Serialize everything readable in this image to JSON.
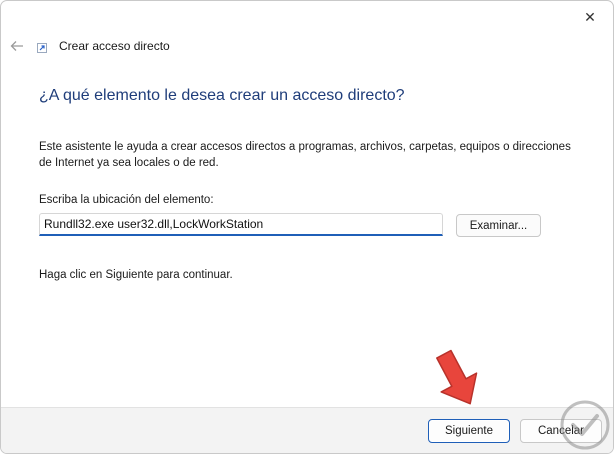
{
  "window": {
    "title": "Crear acceso directo",
    "close_label": "✕"
  },
  "wizard": {
    "heading": "¿A qué elemento le desea crear un acceso directo?",
    "description": "Este asistente le ayuda a crear accesos directos a programas, archivos, carpetas, equipos o direcciones de Internet ya sea locales o de red.",
    "location_label": "Escriba la ubicación del elemento:",
    "location_value": "Rundll32.exe user32.dll,LockWorkStation",
    "browse_label": "Examinar...",
    "continue_text": "Haga clic en Siguiente para continuar."
  },
  "footer": {
    "next_label": "Siguiente",
    "cancel_label": "Cancelar"
  },
  "icons": {
    "back": "back-arrow-icon",
    "close": "close-icon",
    "title": "shortcut-icon",
    "annotation": "red-arrow",
    "watermark": "solvetic-logo"
  },
  "colors": {
    "heading": "#1f3d7a",
    "accent": "#1f5fb8",
    "annotation_arrow": "#e8453c"
  }
}
